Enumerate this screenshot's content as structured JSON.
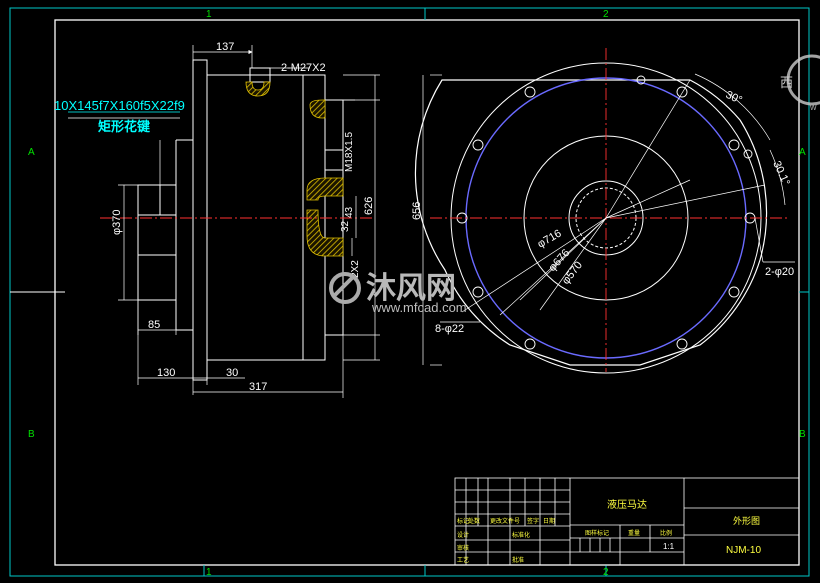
{
  "grid": {
    "col_top": [
      "1",
      "2"
    ],
    "col_bottom": [
      "1",
      "2"
    ],
    "row_left": [
      "A",
      "B"
    ],
    "row_right": [
      "A",
      "B"
    ]
  },
  "side_view": {
    "spline_spec": "10X145f7X160f5X22f9",
    "spline_label": "矩形花键",
    "thread_top": "2-M27X2",
    "thread_mid": "M18X1.5",
    "dims": {
      "d137": "137",
      "d85": "85",
      "d130": "130",
      "d30": "30",
      "d317": "317",
      "phi370": "φ370",
      "d43": "43",
      "d32": "32",
      "d626": "626",
      "d2x2": "2X2"
    }
  },
  "front_view": {
    "d656": "656",
    "phi716": "φ716",
    "phi676": "φ676",
    "phi570": "φ570",
    "ang30": "30°",
    "ang30_1": "30.1°",
    "holes_2": "2-φ20",
    "holes_8": "8-φ22"
  },
  "title_block": {
    "part_name": "液压马达",
    "drawing_kind": "外形图",
    "drawing_no": "NJM-10",
    "scale": "1:1",
    "col_labels": [
      "标记",
      "处数",
      "更改文件号",
      "签字",
      "日期"
    ],
    "row_labels": [
      "设计",
      "审核",
      "工艺"
    ],
    "col_labels_2": [
      "标准化",
      "批准"
    ],
    "stage_labels": [
      "图样标记",
      "重量",
      "比例"
    ]
  },
  "watermark": {
    "brand": "沐风网",
    "url": "www.mfcad.com",
    "side_char": "西",
    "side_char_2": "w"
  },
  "colors": {
    "frame": "#ffffff",
    "border": "#00ffff",
    "centerline": "#ff3030",
    "body": "#ffffff",
    "pcd_circle": "#6a6aff",
    "hatch": "#e0c000",
    "dimension_text": "#ffffff",
    "grid_text": "#00e000"
  }
}
